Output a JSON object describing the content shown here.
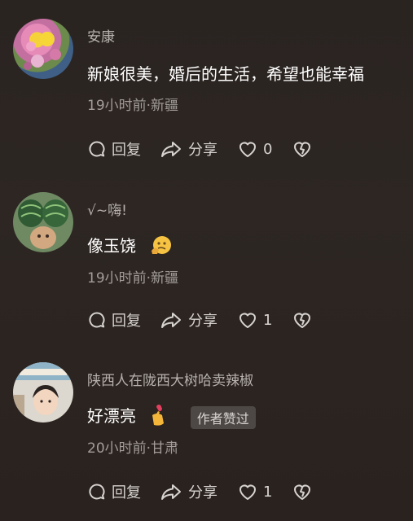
{
  "comments": [
    {
      "author": "安康",
      "text": "新娘很美，婚后的生活，希望也能幸福",
      "meta": "19小时前·新疆",
      "reply_label": "回复",
      "share_label": "分享",
      "like_count": "0",
      "avatar_icon": "flower-avatar"
    },
    {
      "author": "√~嗨!",
      "text": "像玉饶",
      "meta": "19小时前·新疆",
      "reply_label": "回复",
      "share_label": "分享",
      "like_count": "1",
      "avatar_icon": "watermelon-avatar",
      "emoji": "thinking-face-emoji"
    },
    {
      "author": "陕西人在陇西大树哈卖辣椒",
      "text": "好漂亮",
      "badge": "作者赞过",
      "meta": "20小时前·甘肃",
      "reply_label": "回复",
      "share_label": "分享",
      "like_count": "1",
      "avatar_icon": "person-avatar",
      "emoji": "finger-heart-emoji"
    }
  ],
  "colors": {
    "background": "#2a2421",
    "author": "#b7b1ad",
    "meta": "#a39d99",
    "badge_bg": "#4d4845"
  }
}
